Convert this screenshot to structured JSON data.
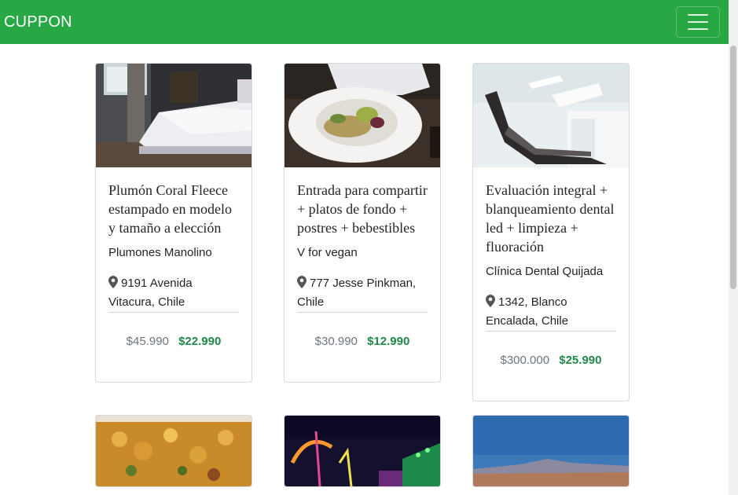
{
  "navbar": {
    "brand": "CUPPON",
    "accent": "#28a745"
  },
  "deals": [
    {
      "title": "Plumón Coral Fleece estampado en modelo y tamaño a elección",
      "vendor": "Plumones Manolino",
      "address": "9191 Avenida Vitacura, Chile",
      "old_price": "$45.990",
      "new_price": "$22.990",
      "image": "bedroom-photo"
    },
    {
      "title": "Entrada para compartir + platos de fondo + postres + bebestibles",
      "vendor": "V for vegan",
      "address": "777 Jesse Pinkman, Chile",
      "old_price": "$30.990",
      "new_price": "$12.990",
      "image": "salad-plate-photo"
    },
    {
      "title": "Evaluación integral + blanqueamiento dental led + limpieza + fluoración",
      "vendor": "Clínica Dental Quijada",
      "address": "1342, Blanco Encalada, Chile",
      "old_price": "$300.000",
      "new_price": "$25.990",
      "image": "dental-chair-photo"
    },
    {
      "image": "chickpea-dish-photo"
    },
    {
      "image": "night-fair-photo"
    },
    {
      "image": "mountain-landscape-photo"
    }
  ]
}
